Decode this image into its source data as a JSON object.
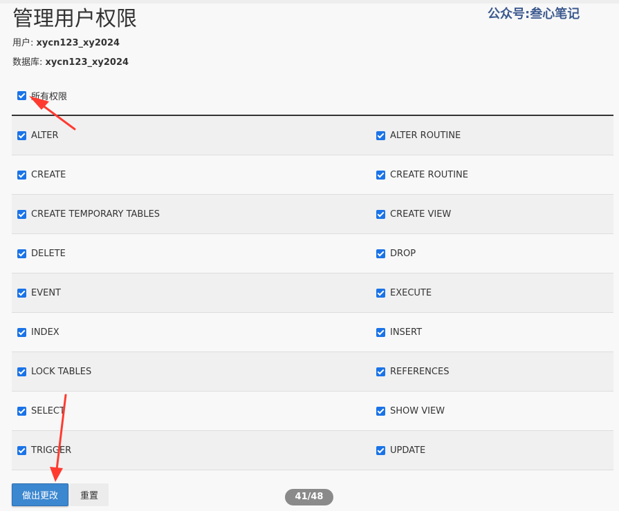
{
  "watermark": "公众号:叁心笔记",
  "page": {
    "title": "管理用户权限",
    "user_label": "用户:",
    "user_value": "xycn123_xy2024",
    "db_label": "数据库:",
    "db_value": "xycn123_xy2024"
  },
  "all_privileges": {
    "label": "所有权限",
    "checked": true
  },
  "privileges": [
    [
      "ALTER",
      "ALTER ROUTINE"
    ],
    [
      "CREATE",
      "CREATE ROUTINE"
    ],
    [
      "CREATE TEMPORARY TABLES",
      "CREATE VIEW"
    ],
    [
      "DELETE",
      "DROP"
    ],
    [
      "EVENT",
      "EXECUTE"
    ],
    [
      "INDEX",
      "INSERT"
    ],
    [
      "LOCK TABLES",
      "REFERENCES"
    ],
    [
      "SELECT",
      "SHOW VIEW"
    ],
    [
      "TRIGGER",
      "UPDATE"
    ]
  ],
  "buttons": {
    "submit": "做出更改",
    "reset": "重置"
  },
  "pager": "41/48",
  "colors": {
    "checkbox": "#1a73e8",
    "primary_button": "#3b87d0",
    "annotation_arrow": "#ff3b30",
    "watermark": "#3d5a8f"
  }
}
